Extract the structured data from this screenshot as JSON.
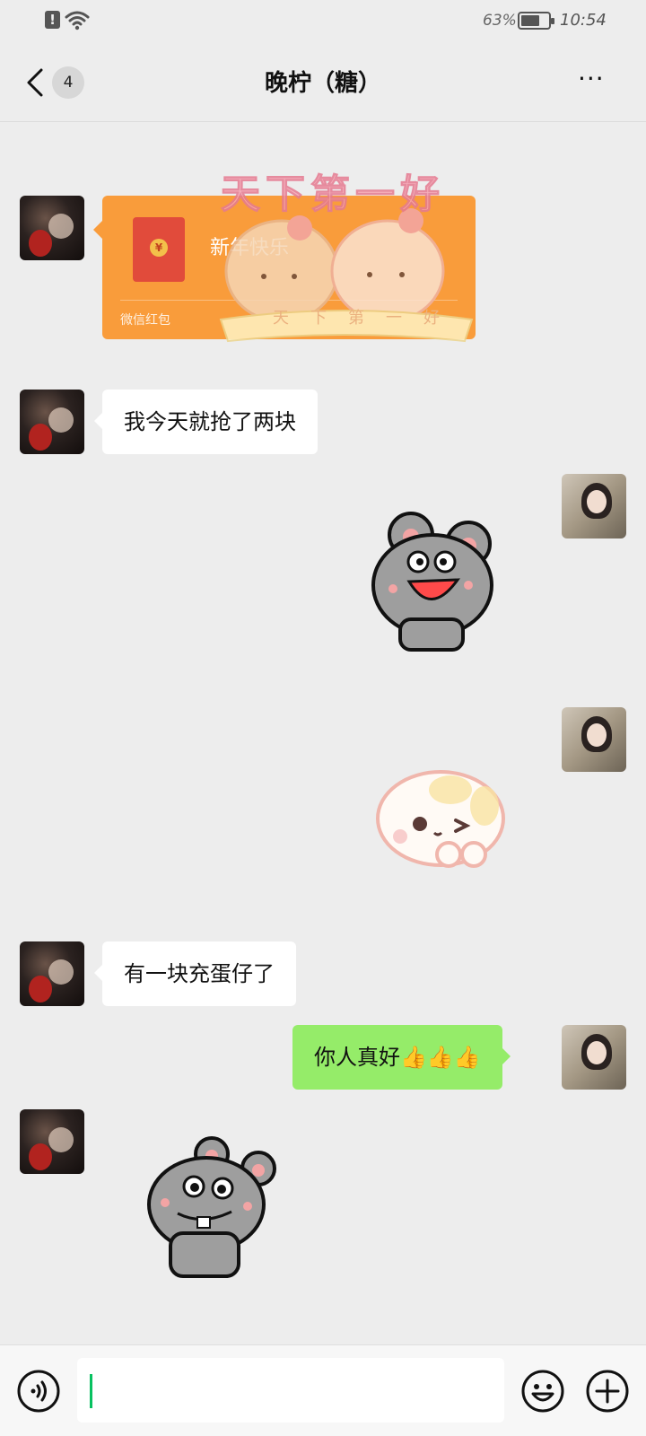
{
  "status_bar": {
    "battery_percent": "63%",
    "time": "10:54"
  },
  "header": {
    "back_count": "4",
    "title": "晚柠（糖）",
    "more_label": "···"
  },
  "messages": {
    "red_packet": {
      "title": "新年快乐",
      "label": "微信红包",
      "coin_symbol": "¥"
    },
    "overlay_sticker": {
      "title": "天下第一好",
      "subtitle": "天下第一好"
    },
    "text_1": "我今天就抢了两块",
    "text_2": "有一块充蛋仔了",
    "text_3": "你人真好👍👍👍"
  },
  "input_bar": {
    "placeholder": ""
  },
  "colors": {
    "outgoing_bubble": "#95ec69",
    "incoming_bubble": "#ffffff",
    "red_packet": "#f99c3b",
    "background": "#ededed"
  },
  "icons": [
    "alert-icon",
    "wifi-icon",
    "battery-icon",
    "back-chevron-icon",
    "more-icon",
    "voice-icon",
    "emoji-icon",
    "plus-icon"
  ]
}
